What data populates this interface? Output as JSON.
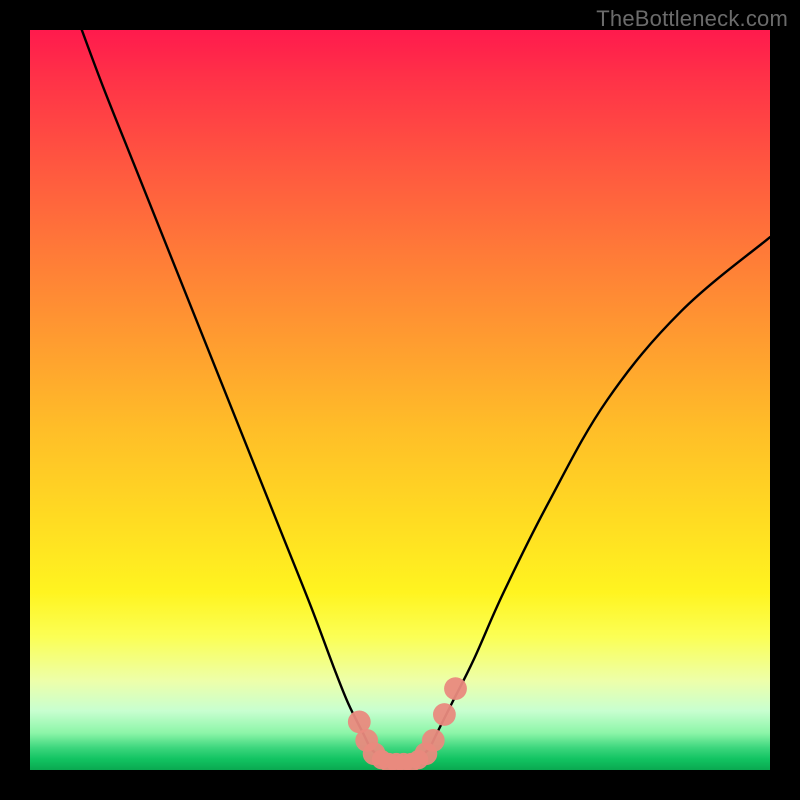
{
  "watermark": {
    "text": "TheBottleneck.com"
  },
  "chart_data": {
    "type": "line",
    "title": "",
    "xlabel": "",
    "ylabel": "",
    "xlim": [
      0,
      100
    ],
    "ylim": [
      0,
      100
    ],
    "series": [
      {
        "name": "bottleneck-curve",
        "x": [
          7,
          10,
          14,
          18,
          22,
          26,
          30,
          34,
          38,
          41,
          43,
          45,
          46,
          47,
          48,
          49,
          50,
          51,
          52,
          53,
          54,
          55,
          57,
          60,
          64,
          70,
          78,
          88,
          100
        ],
        "y": [
          100,
          92,
          82,
          72,
          62,
          52,
          42,
          32,
          22,
          14,
          9,
          5,
          3,
          2,
          1.2,
          1,
          1,
          1,
          1.2,
          2,
          3,
          5,
          9,
          15,
          24,
          36,
          50,
          62,
          72
        ]
      }
    ],
    "markers": {
      "name": "bottleneck-range-markers",
      "color": "#e98a7e",
      "points": [
        {
          "x": 44.5,
          "y": 6.5,
          "r": 1.4
        },
        {
          "x": 45.5,
          "y": 4.0,
          "r": 1.4
        },
        {
          "x": 46.5,
          "y": 2.2,
          "r": 1.4
        },
        {
          "x": 47.5,
          "y": 1.4,
          "r": 1.2
        },
        {
          "x": 48.5,
          "y": 1.0,
          "r": 1.2
        },
        {
          "x": 49.5,
          "y": 1.0,
          "r": 1.2
        },
        {
          "x": 50.5,
          "y": 1.0,
          "r": 1.2
        },
        {
          "x": 51.5,
          "y": 1.0,
          "r": 1.2
        },
        {
          "x": 52.5,
          "y": 1.4,
          "r": 1.2
        },
        {
          "x": 53.5,
          "y": 2.2,
          "r": 1.4
        },
        {
          "x": 54.5,
          "y": 4.0,
          "r": 1.4
        },
        {
          "x": 56.0,
          "y": 7.5,
          "r": 1.4
        },
        {
          "x": 57.5,
          "y": 11.0,
          "r": 1.4
        }
      ]
    },
    "grid": false,
    "legend": false
  }
}
